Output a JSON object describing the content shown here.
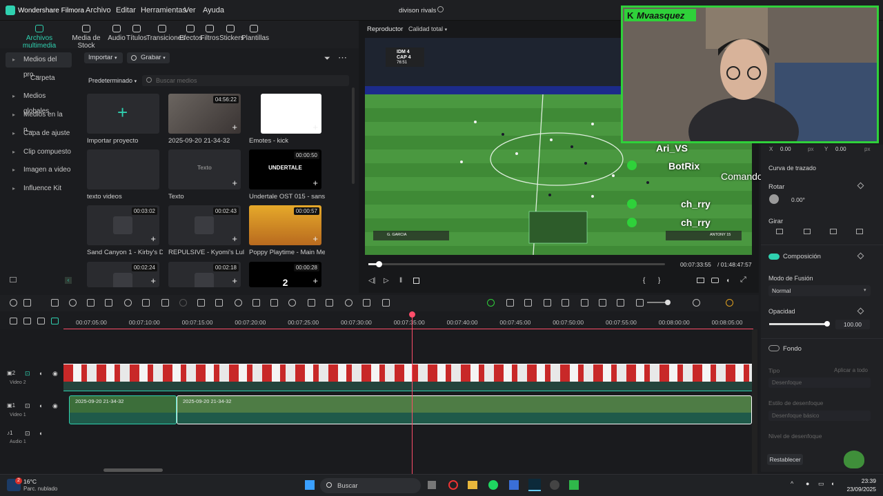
{
  "app": {
    "name": "Wondershare Filmora",
    "project": "divison rivals",
    "menus": [
      "Archivo",
      "Editar",
      "Herramientas",
      "Ver",
      "Ayuda"
    ]
  },
  "top_tabs": [
    {
      "label": "Archivos multimedia",
      "icon": "media-icon"
    },
    {
      "label": "Media de Stock",
      "icon": "stock-icon"
    },
    {
      "label": "Audio",
      "icon": "audio-icon"
    },
    {
      "label": "Títulos",
      "icon": "titles-icon"
    },
    {
      "label": "Transiciones",
      "icon": "transitions-icon"
    },
    {
      "label": "Efectos",
      "icon": "effects-icon"
    },
    {
      "label": "Filtros",
      "icon": "filters-icon"
    },
    {
      "label": "Stickers",
      "icon": "stickers-icon"
    },
    {
      "label": "Plantillas",
      "icon": "templates-icon"
    }
  ],
  "sidebar": [
    {
      "label": "Medios del pro...",
      "selected": true
    },
    {
      "label": "Carpeta"
    },
    {
      "label": "Medios globales"
    },
    {
      "label": "Medios en la n..."
    },
    {
      "label": "Capa de ajuste"
    },
    {
      "label": "Clip compuesto"
    },
    {
      "label": "Imagen a video"
    },
    {
      "label": "Influence Kit"
    }
  ],
  "media_toolbar": {
    "import": "Importar",
    "record": "Grabar",
    "sort": "Predeterminado",
    "search_placeholder": "Buscar medios"
  },
  "media_items": [
    {
      "label": "Importar proyecto",
      "duration": ""
    },
    {
      "label": "2025-09-20 21-34-32",
      "duration": "04:56:22"
    },
    {
      "label": "Emotes - kick",
      "duration": ""
    },
    {
      "label": "texto videos",
      "duration": ""
    },
    {
      "label": "Texto",
      "duration": "",
      "inner": "Texto"
    },
    {
      "label": "Undertale OST 015 - sans. (To...",
      "duration": "00:00:50",
      "inner": "UNDERTALE"
    },
    {
      "label": "Sand Canyon 1 - Kirby's Dre...",
      "duration": "00:03:02"
    },
    {
      "label": "REPULSIVE - Kyomi's Lullaby...",
      "duration": "00:02:43"
    },
    {
      "label": "Poppy Playtime - Main Men...",
      "duration": "00:00:57"
    },
    {
      "label": "",
      "duration": "00:02:24"
    },
    {
      "label": "",
      "duration": "00:02:18"
    },
    {
      "label": "",
      "duration": "00:00:28",
      "inner": "2"
    }
  ],
  "player": {
    "tab": "Reproductor",
    "quality": "Calidad total",
    "current_time": "00:07:33:55",
    "total_time": "/ 01:48:47:57",
    "progress": 0.035
  },
  "scoreboard": {
    "t1": "IDM",
    "s1": "4",
    "t2": "CAP",
    "s2": "4",
    "clock": "76:51"
  },
  "players_on_screen": {
    "left": "G. GARCIA",
    "right": "ANTONY 15"
  },
  "overlay": {
    "streamer": "Mvaasquez",
    "chat": [
      "Ari_VS",
      "BotRix",
      "Comandos:!points!shop!comman ds",
      "ch_rry",
      "ch_rry"
    ]
  },
  "right_panel": {
    "x_label": "X",
    "x_val": "0.00",
    "y_label": "Y",
    "y_val": "0.00",
    "unit": "px",
    "curve": "Curva de trazado",
    "rotate": "Rotar",
    "rotate_val": "0.00°",
    "flip": "Girar",
    "composition": "Composición",
    "blend_label": "Modo de Fusión",
    "blend_val": "Normal",
    "opacity_label": "Opacidad",
    "opacity_val": "100.00",
    "opacity_level": 1.0,
    "background": "Fondo",
    "type_label": "Tipo",
    "apply_all": "Aplicar a todo",
    "blur": "Desenfoque",
    "blur_style_label": "Estilo de desenfoque",
    "blur_style_val": "Desenfoque básico",
    "blur_level": "Nivel de desenfoque",
    "reset": "Restablecer"
  },
  "ruler": [
    "00:07:05:00",
    "00:07:10:00",
    "00:07:15:00",
    "00:07:20:00",
    "00:07:25:00",
    "00:07:30:00",
    "00:07:35:00",
    "00:07:40:00",
    "00:07:45:00",
    "00:07:50:00",
    "00:07:55:00",
    "00:08:00:00",
    "00:08:05:00"
  ],
  "tracks": [
    {
      "num": "2",
      "name": "Video 2"
    },
    {
      "num": "1",
      "name": "Video 1",
      "clips": [
        "2025-09-20 21-34-32",
        "2025-09-20 21-34-32"
      ]
    },
    {
      "num": "1",
      "name": "Audio 1"
    }
  ],
  "taskbar": {
    "weather_temp": "16°C",
    "weather_desc": "Parc. nublado",
    "search": "Buscar",
    "time": "23:39",
    "date": "23/09/2025",
    "notif": "2"
  },
  "colors": {
    "accent": "#2fd1b0",
    "playhead": "#ff4d6a",
    "bg": "#1b1c1f"
  }
}
